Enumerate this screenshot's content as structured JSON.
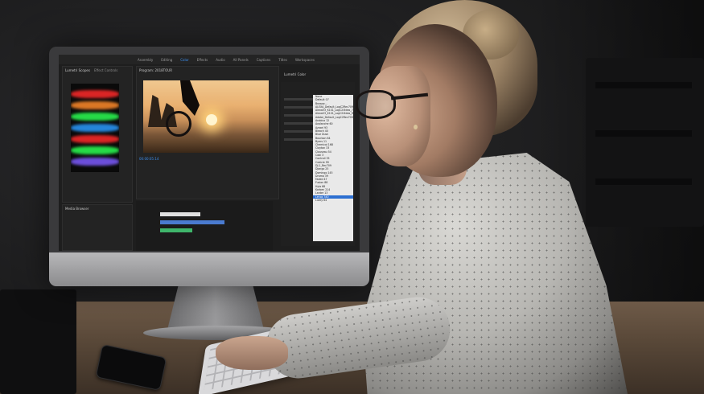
{
  "scene": {
    "description_colors": {
      "background": "#1c1c1d",
      "desk": "#5a4939",
      "screen_accent": "#3b8ff0"
    }
  },
  "app": {
    "menu": [
      "Assembly",
      "Editing",
      "Color",
      "Effects",
      "Audio",
      "All Panels",
      "Captions",
      "Titles",
      "Workspaces"
    ],
    "active_menu_index": 2,
    "panels": {
      "scopes_tab": "Lumetri Scopes",
      "effect_controls_tab": "Effect Controls",
      "program_tab": "Program: 2018TOUR",
      "media_browser_tab": "Media Browser",
      "lumetri_color_tab": "Lumetri Color"
    },
    "timecode": "00:00:05:14",
    "dropdown_items": [
      "None",
      "Default 07",
      "Browse...",
      "ALEXA_Default_LogC2Rec709",
      "AlexaV3_K1S1_LogC2Video_709",
      "AlexaV3_K1S1_LogC2Video_Rec709",
      "Adobe_Default_LogC2Rec709",
      "Arabica 12",
      "Avalanche 60",
      "Azrael 93",
      "Bleach 40",
      "Blue Dusk",
      "Bourbon 64",
      "Byers 11",
      "Chemical 168",
      "Clayton 33",
      "Clouseau 54",
      "Cobi 3",
      "Contrail 35",
      "Cubicle 99",
      "DJ-1_Rec709",
      "Django 25",
      "Domingo 145",
      "Drama 39",
      "Faded 47",
      "Fusion 88",
      "Hyla 68",
      "Korben 214",
      "Lanter 13",
      "Lenox 340",
      "Lucky 64"
    ],
    "dropdown_selected_index": 29
  }
}
